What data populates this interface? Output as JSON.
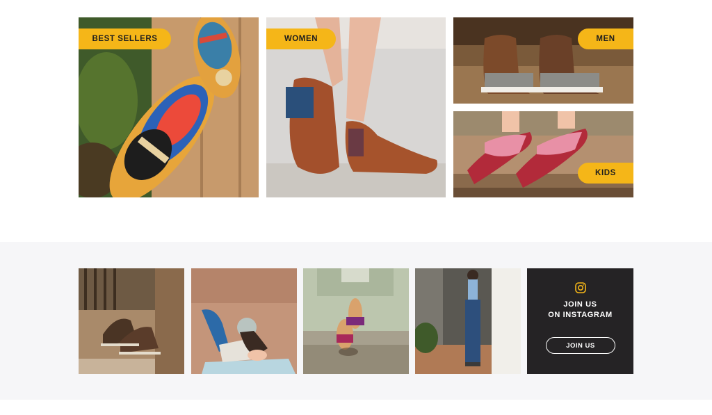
{
  "categories": {
    "best_sellers": "BEST SELLERS",
    "women": "WOMEN",
    "men": "MEN",
    "kids": "KIDS"
  },
  "instagram": {
    "title": "JOIN US\nON INSTAGRAM",
    "button_label": "JOIN US",
    "icon": "instagram-icon"
  },
  "colors": {
    "accent": "#f5b618",
    "band_background": "#f6f6f8",
    "card_background": "#252325",
    "text_dark": "#1e1e1e"
  }
}
